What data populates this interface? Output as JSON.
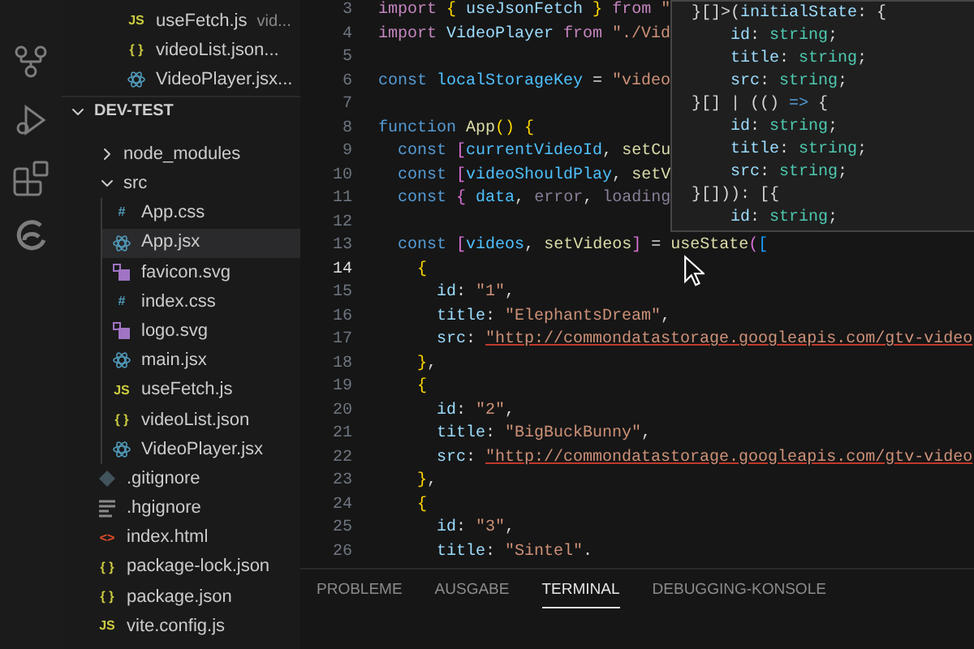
{
  "activity_bar": [
    {
      "kind": "source-control",
      "selected": false
    },
    {
      "kind": "run-debug",
      "selected": false
    },
    {
      "kind": "extensions",
      "selected": false
    },
    {
      "kind": "browser",
      "selected": false
    }
  ],
  "open_editors": [
    {
      "glyph": "JS",
      "kind": "js",
      "name": "useFetch.js",
      "description": "vid..."
    },
    {
      "glyph": "{ }",
      "kind": "json",
      "name": "videoList.json..."
    },
    {
      "kind": "react",
      "name": "VideoPlayer.jsx..."
    }
  ],
  "explorer": {
    "title": "DEV-TEST",
    "expanded": true,
    "items": [
      {
        "kind": "folder",
        "children": [
          {
            "kind": "folder",
            "name": "node_modules",
            "expanded": false
          },
          {
            "kind": "folder",
            "name": "src",
            "expanded": true,
            "children": [
              {
                "kind": "css",
                "glyph": "#",
                "name": "App.css",
                "selected": false
              },
              {
                "kind": "react",
                "name": "App.jsx",
                "selected": true
              },
              {
                "kind": "svg",
                "name": "favicon.svg",
                "selected": false
              },
              {
                "kind": "css",
                "glyph": "#",
                "name": "index.css",
                "selected": false
              },
              {
                "kind": "svg",
                "name": "logo.svg",
                "selected": false
              },
              {
                "kind": "react",
                "name": "main.jsx",
                "selected": false
              },
              {
                "kind": "js",
                "glyph": "JS",
                "name": "useFetch.js",
                "selected": false
              },
              {
                "kind": "json",
                "glyph": "{ }",
                "name": "videoList.json",
                "selected": false
              },
              {
                "kind": "react",
                "name": "VideoPlayer.jsx",
                "selected": false
              }
            ]
          },
          {
            "kind": "git",
            "name": ".gitignore",
            "selected": false
          },
          {
            "kind": "lines",
            "name": ".hgignore",
            "selected": false
          },
          {
            "kind": "html",
            "glyph": "<>",
            "name": "index.html",
            "selected": false
          },
          {
            "kind": "json",
            "glyph": "{ }",
            "name": "package-lock.json",
            "selected": false
          },
          {
            "kind": "json",
            "glyph": "{ }",
            "name": "package.json",
            "selected": false
          },
          {
            "kind": "js",
            "glyph": "JS",
            "name": "vite.config.js",
            "selected": false
          }
        ]
      }
    ]
  },
  "editor": {
    "lines": [
      {
        "number": "3",
        "current": false,
        "tokens": [
          {
            "kind": "control",
            "text": "import "
          },
          {
            "kind": "bracket",
            "text": "{ "
          },
          {
            "kind": "variable",
            "text": "useJsonFetch "
          },
          {
            "kind": "bracket",
            "text": "} "
          },
          {
            "kind": "control",
            "text": "from "
          },
          {
            "kind": "string",
            "text": "\""
          }
        ]
      },
      {
        "number": "4",
        "current": false,
        "tokens": [
          {
            "kind": "control",
            "text": "import "
          },
          {
            "kind": "variable",
            "text": "VideoPlayer "
          },
          {
            "kind": "control",
            "text": "from "
          },
          {
            "kind": "string",
            "text": "\"./Vid"
          }
        ]
      },
      {
        "number": "5",
        "current": false
      },
      {
        "number": "6",
        "current": false,
        "tokens": [
          {
            "kind": "storage",
            "text": "const "
          },
          {
            "kind": "constant",
            "text": "localStorageKey "
          },
          {
            "kind": "punct",
            "text": "= "
          },
          {
            "kind": "string",
            "text": "\"video"
          }
        ]
      },
      {
        "number": "7",
        "current": false
      },
      {
        "number": "8",
        "current": false,
        "tokens": [
          {
            "kind": "storage",
            "text": "function "
          },
          {
            "kind": "function",
            "text": "App"
          },
          {
            "kind": "bracket",
            "text": "() {"
          }
        ]
      },
      {
        "number": "9",
        "current": false,
        "tokens": [
          {
            "kind": "storage",
            "text": "  const "
          },
          {
            "kind": "bracket2",
            "text": "["
          },
          {
            "kind": "constant",
            "text": "currentVideoId"
          },
          {
            "kind": "punct",
            "text": ", "
          },
          {
            "kind": "function",
            "text": "setCu"
          }
        ]
      },
      {
        "number": "10",
        "current": false,
        "tokens": [
          {
            "kind": "storage",
            "text": "  const "
          },
          {
            "kind": "bracket2",
            "text": "["
          },
          {
            "kind": "constant",
            "text": "videoShouldPlay"
          },
          {
            "kind": "punct",
            "text": ", "
          },
          {
            "kind": "function",
            "text": "setV"
          }
        ]
      },
      {
        "number": "11",
        "current": false,
        "tokens": [
          {
            "kind": "storage",
            "text": "  const "
          },
          {
            "kind": "bracket2",
            "text": "{ "
          },
          {
            "kind": "constant",
            "text": "data"
          },
          {
            "kind": "punct",
            "text": ", "
          },
          {
            "kind": "unused",
            "text": "error"
          },
          {
            "kind": "punct",
            "text": ", "
          },
          {
            "kind": "unused",
            "text": "loading"
          }
        ]
      },
      {
        "number": "12",
        "current": false
      },
      {
        "number": "13",
        "current": false,
        "tokens": [
          {
            "kind": "storage",
            "text": "  const "
          },
          {
            "kind": "bracket2",
            "text": "["
          },
          {
            "kind": "constant",
            "text": "videos"
          },
          {
            "kind": "punct",
            "text": ", "
          },
          {
            "kind": "function",
            "text": "setVideos"
          },
          {
            "kind": "bracket2",
            "text": "] "
          },
          {
            "kind": "punct",
            "text": "= "
          },
          {
            "kind": "function",
            "text": "useState"
          },
          {
            "kind": "bracket2",
            "text": "("
          },
          {
            "kind": "bracket3",
            "text": "["
          }
        ]
      },
      {
        "number": "14",
        "current": true,
        "tokens": [
          {
            "kind": "bracket",
            "text": "    {"
          }
        ]
      },
      {
        "number": "15",
        "current": false,
        "tokens": [
          {
            "kind": "variable",
            "text": "      id"
          },
          {
            "kind": "punct",
            "text": ": "
          },
          {
            "kind": "string",
            "text": "\"1\""
          },
          {
            "kind": "punct",
            "text": ","
          }
        ]
      },
      {
        "number": "16",
        "current": false,
        "tokens": [
          {
            "kind": "variable",
            "text": "      title"
          },
          {
            "kind": "punct",
            "text": ": "
          },
          {
            "kind": "string",
            "text": "\"ElephantsDream\""
          },
          {
            "kind": "punct",
            "text": ","
          }
        ]
      },
      {
        "number": "17",
        "current": false,
        "tokens": [
          {
            "kind": "variable",
            "text": "      src"
          },
          {
            "kind": "punct",
            "text": ": "
          },
          {
            "kind": "url",
            "text": "\"http://commondatastorage.googleapis.com/gtv-video"
          }
        ]
      },
      {
        "number": "18",
        "current": false,
        "tokens": [
          {
            "kind": "bracket",
            "text": "    }"
          },
          {
            "kind": "punct",
            "text": ","
          }
        ]
      },
      {
        "number": "19",
        "current": false,
        "tokens": [
          {
            "kind": "bracket",
            "text": "    {"
          }
        ]
      },
      {
        "number": "20",
        "current": false,
        "tokens": [
          {
            "kind": "variable",
            "text": "      id"
          },
          {
            "kind": "punct",
            "text": ": "
          },
          {
            "kind": "string",
            "text": "\"2\""
          },
          {
            "kind": "punct",
            "text": ","
          }
        ]
      },
      {
        "number": "21",
        "current": false,
        "tokens": [
          {
            "kind": "variable",
            "text": "      title"
          },
          {
            "kind": "punct",
            "text": ": "
          },
          {
            "kind": "string",
            "text": "\"BigBuckBunny\""
          },
          {
            "kind": "punct",
            "text": ","
          }
        ]
      },
      {
        "number": "22",
        "current": false,
        "tokens": [
          {
            "kind": "variable",
            "text": "      src"
          },
          {
            "kind": "punct",
            "text": ": "
          },
          {
            "kind": "url",
            "text": "\"http://commondatastorage.googleapis.com/gtv-video"
          }
        ]
      },
      {
        "number": "23",
        "current": false,
        "tokens": [
          {
            "kind": "bracket",
            "text": "    }"
          },
          {
            "kind": "punct",
            "text": ","
          }
        ]
      },
      {
        "number": "24",
        "current": false,
        "tokens": [
          {
            "kind": "bracket",
            "text": "    {"
          }
        ]
      },
      {
        "number": "25",
        "current": false,
        "tokens": [
          {
            "kind": "variable",
            "text": "      id"
          },
          {
            "kind": "punct",
            "text": ": "
          },
          {
            "kind": "string",
            "text": "\"3\""
          },
          {
            "kind": "punct",
            "text": ","
          }
        ]
      },
      {
        "number": "26",
        "current": false,
        "tokens": [
          {
            "kind": "variable",
            "text": "      title"
          },
          {
            "kind": "punct",
            "text": ": "
          },
          {
            "kind": "string",
            "text": "\"Sintel\""
          },
          {
            "kind": "punct",
            "text": "."
          }
        ]
      }
    ]
  },
  "hover": {
    "lines": [
      [
        {
          "kind": "punct",
          "text": "}[]>("
        },
        {
          "kind": "variable",
          "text": "initialState"
        },
        {
          "kind": "punct",
          "text": ": {"
        }
      ],
      [
        {
          "kind": "variable",
          "text": "    id"
        },
        {
          "kind": "punct",
          "text": ": "
        },
        {
          "kind": "type",
          "text": "string"
        },
        {
          "kind": "punct",
          "text": ";"
        }
      ],
      [
        {
          "kind": "variable",
          "text": "    title"
        },
        {
          "kind": "punct",
          "text": ": "
        },
        {
          "kind": "type",
          "text": "string"
        },
        {
          "kind": "punct",
          "text": ";"
        }
      ],
      [
        {
          "kind": "variable",
          "text": "    src"
        },
        {
          "kind": "punct",
          "text": ": "
        },
        {
          "kind": "type",
          "text": "string"
        },
        {
          "kind": "punct",
          "text": ";"
        }
      ],
      [
        {
          "kind": "punct",
          "text": "}[] | (() "
        },
        {
          "kind": "storage",
          "text": "=>"
        },
        {
          "kind": "punct",
          "text": " {"
        }
      ],
      [
        {
          "kind": "variable",
          "text": "    id"
        },
        {
          "kind": "punct",
          "text": ": "
        },
        {
          "kind": "type",
          "text": "string"
        },
        {
          "kind": "punct",
          "text": ";"
        }
      ],
      [
        {
          "kind": "variable",
          "text": "    title"
        },
        {
          "kind": "punct",
          "text": ": "
        },
        {
          "kind": "type",
          "text": "string"
        },
        {
          "kind": "punct",
          "text": ";"
        }
      ],
      [
        {
          "kind": "variable",
          "text": "    src"
        },
        {
          "kind": "punct",
          "text": ": "
        },
        {
          "kind": "type",
          "text": "string"
        },
        {
          "kind": "punct",
          "text": ";"
        }
      ],
      [
        {
          "kind": "punct",
          "text": "}[])): [{"
        }
      ],
      [
        {
          "kind": "variable",
          "text": "    id"
        },
        {
          "kind": "punct",
          "text": ": "
        },
        {
          "kind": "type",
          "text": "string"
        },
        {
          "kind": "punct",
          "text": ";"
        }
      ]
    ]
  },
  "panel": {
    "tabs": [
      {
        "label": "PROBLEME",
        "selected": false
      },
      {
        "label": "AUSGABE",
        "selected": false
      },
      {
        "label": "TERMINAL",
        "selected": true
      },
      {
        "label": "DEBUGGING-KONSOLE",
        "selected": false
      }
    ]
  }
}
